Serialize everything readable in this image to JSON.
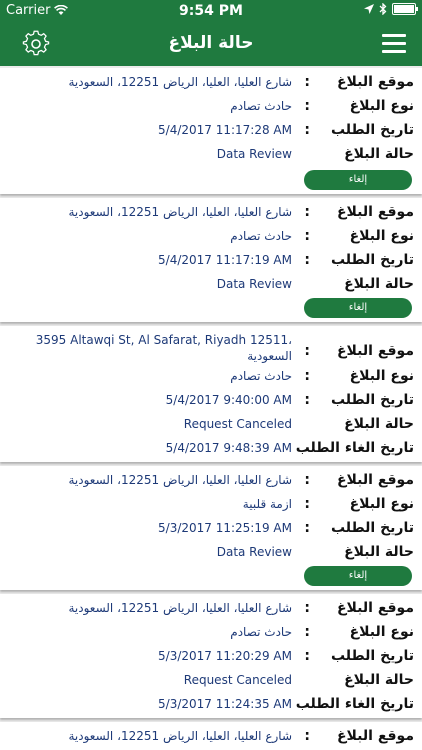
{
  "status_bar": {
    "carrier": "Carrier",
    "time": "9:54 PM"
  },
  "nav": {
    "title": "حالة البلاغ"
  },
  "labels": {
    "location": "موقع البلاغ",
    "type": "نوع البلاغ",
    "request_date": "تاريخ الطلب",
    "status": "حالة البلاغ",
    "cancel_date": "تاريخ الغاء الطلب"
  },
  "reports": [
    {
      "location": "شارع العليا، العليا، الرياض 12251، السعودية",
      "type": "حادث تصادم",
      "date": "5/4/2017 11:17:28 AM",
      "status": "Data Review",
      "cancel_label": "إلغاء"
    },
    {
      "location": "شارع العليا، العليا، الرياض 12251، السعودية",
      "type": "حادث تصادم",
      "date": "5/4/2017 11:17:19 AM",
      "status": "Data Review",
      "cancel_label": "إلغاء"
    },
    {
      "location_line1": "3595 Altawqi St, Al Safarat, Riyadh 12511،",
      "location_line2": "السعودية",
      "type": "حادث تصادم",
      "date": "5/4/2017 9:40:00 AM",
      "status": "Request Canceled",
      "cancel_date": "5/4/2017 9:48:39 AM"
    },
    {
      "location": "شارع العليا، العليا، الرياض 12251، السعودية",
      "type": "ازمة قلبية",
      "date": "5/3/2017 11:25:19 AM",
      "status": "Data Review",
      "cancel_label": "إلغاء"
    },
    {
      "location": "شارع العليا، العليا، الرياض 12251، السعودية",
      "type": "حادث تصادم",
      "date": "5/3/2017 11:20:29 AM",
      "status": "Request Canceled",
      "cancel_date": "5/3/2017 11:24:35 AM"
    },
    {
      "location": "شارع العليا، العليا، الرياض 12251، السعودية"
    }
  ]
}
